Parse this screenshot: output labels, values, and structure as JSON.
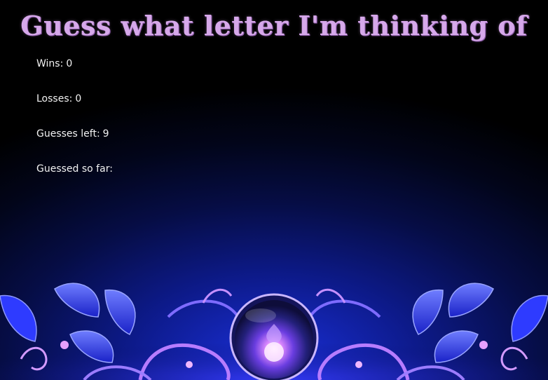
{
  "title": "Guess what letter I'm thinking of",
  "stats": {
    "wins_label": "Wins:",
    "wins_value": "0",
    "losses_label": "Losses:",
    "losses_value": "0",
    "guesses_left_label": "Guesses left:",
    "guesses_left_value": "9",
    "guessed_so_far_label": "Guessed so far:",
    "guessed_so_far_value": ""
  },
  "colors": {
    "title": "#d6a8ea",
    "text": "#f2f2f2",
    "background_glow": "#1a2fd8",
    "ornament_leaf": "#3b4bff",
    "ornament_swirl": "#c07cff",
    "orb_core": "#ffd6ff"
  },
  "decoration": {
    "ornament_icon": "crystal-orb-floral-ornament-icon"
  }
}
